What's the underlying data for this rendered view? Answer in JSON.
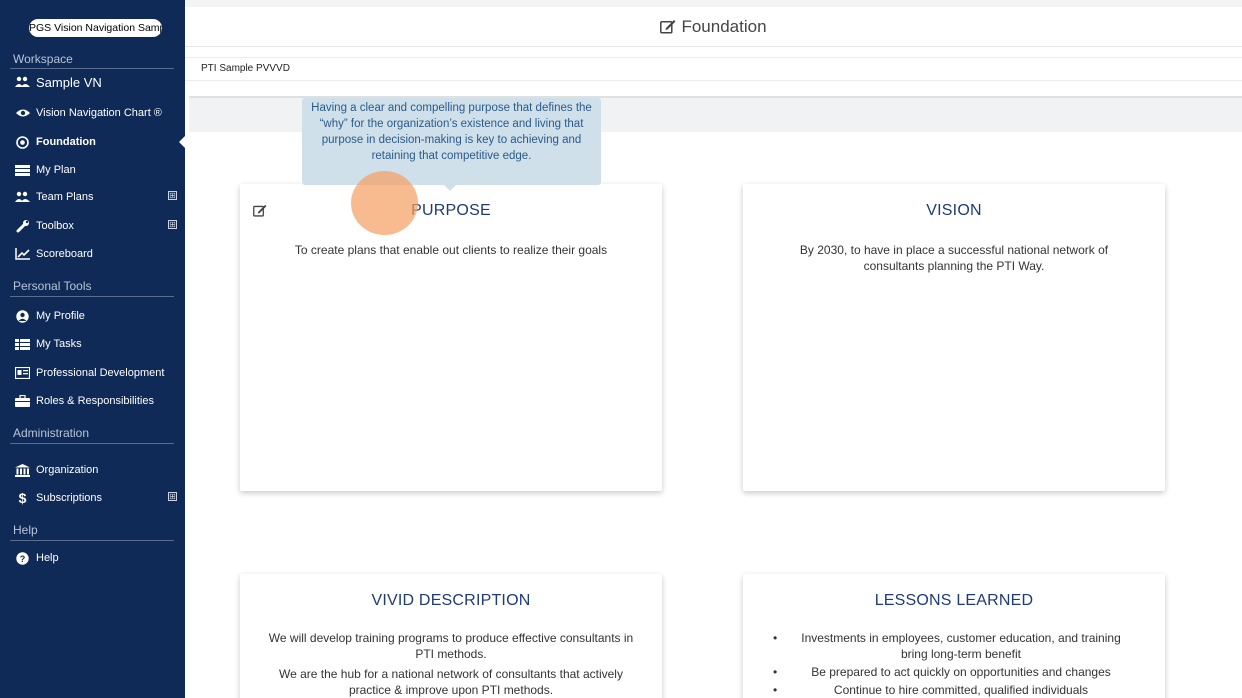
{
  "sidebar": {
    "workspace_select": "PGS Vision Navigation Sample",
    "sections": {
      "workspace": "Workspace",
      "personal_tools": "Personal Tools",
      "administration": "Administration",
      "help": "Help"
    },
    "workspace_name": "Sample VN",
    "items": {
      "vision_chart": "Vision Navigation Chart ®",
      "foundation": "Foundation",
      "my_plan": "My Plan",
      "team_plans": "Team Plans",
      "toolbox": "Toolbox",
      "scoreboard": "Scoreboard",
      "my_profile": "My Profile",
      "my_tasks": "My Tasks",
      "professional_development": "Professional Development",
      "roles": "Roles & Responsibilities",
      "organization": "Organization",
      "subscriptions": "Subscriptions",
      "help": "Help"
    },
    "expand_symbol": "⊞"
  },
  "header": {
    "title": "Foundation",
    "plan_name": "PTI Sample PVVVD"
  },
  "tooltip": {
    "text": "Having a clear and compelling purpose that defines the “why” for the organization’s existence and living that purpose in decision-making is key to achieving and retaining that competitive edge."
  },
  "cards": {
    "purpose": {
      "title": "PURPOSE",
      "text": "To create plans that enable out clients to realize their goals"
    },
    "vision": {
      "title": "VISION",
      "text": "By 2030, to have in place a successful national network of consultants planning the PTI Way."
    },
    "vivid": {
      "title": "VIVID DESCRIPTION",
      "line1": "We will develop training programs to produce effective consultants in PTI methods.",
      "line2": "We are the hub for a national network of consultants that actively practice & improve upon PTI methods."
    },
    "lessons": {
      "title": "LESSONS LEARNED",
      "items": [
        "Investments in employees, customer education, and training bring long-term benefit",
        "Be prepared to act quickly on opportunities and changes",
        "Continue to hire committed, qualified individuals"
      ]
    }
  },
  "colors": {
    "sidebar_bg": "#0f2a56",
    "card_title": "#1f3a78",
    "tooltip_bg": "#cfe0ea"
  }
}
